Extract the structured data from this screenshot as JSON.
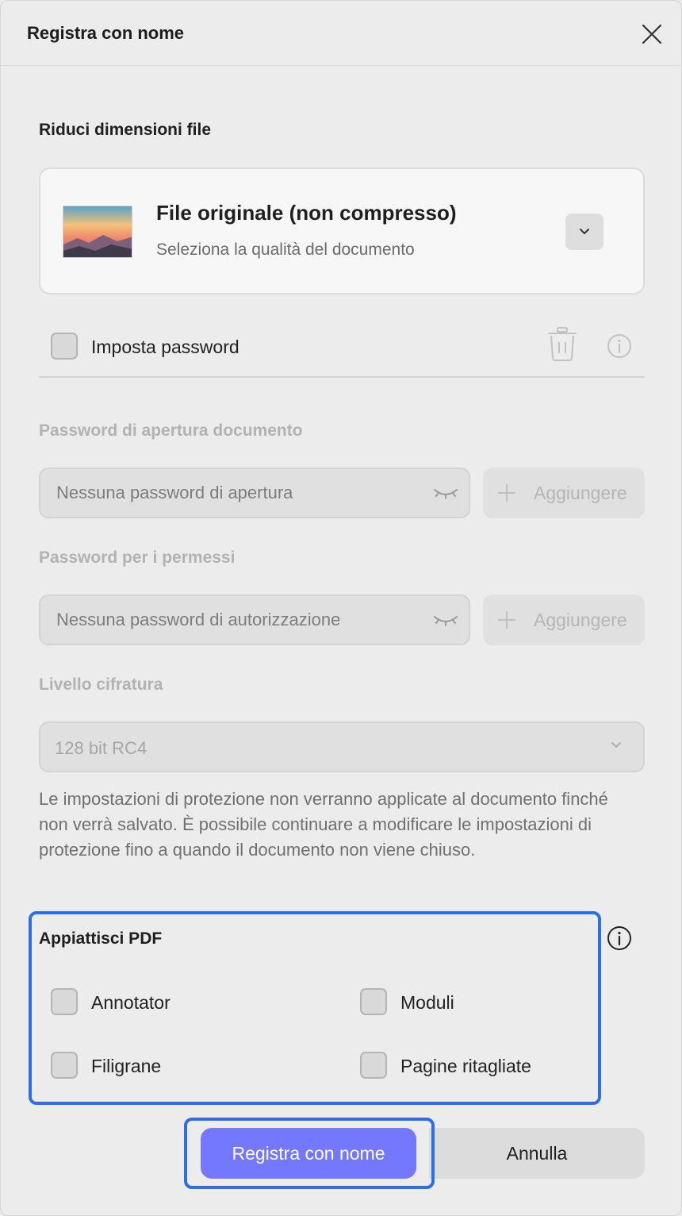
{
  "dialog": {
    "title": "Registra con nome"
  },
  "reduce": {
    "section_title": "Riduci dimensioni file",
    "card_title": "File originale (non compresso)",
    "card_subtitle": "Seleziona la qualità del documento"
  },
  "password": {
    "set_password_label": "Imposta password",
    "open_title": "Password di apertura documento",
    "open_placeholder": "Nessuna password di apertura",
    "open_add_label": "Aggiungere",
    "perm_title": "Password per i permessi",
    "perm_placeholder": "Nessuna password di autorizzazione",
    "perm_add_label": "Aggiungere",
    "encryption_title": "Livello cifratura",
    "encryption_value": "128 bit RC4",
    "note": "Le impostazioni di protezione non verranno applicate al documento finché non verrà salvato. È possibile continuare a modificare le impostazioni di protezione fino a quando il documento non viene chiuso."
  },
  "flatten": {
    "section_title": "Appiattisci PDF",
    "options": [
      "Annotator",
      "Moduli",
      "Filigrane",
      "Pagine ritagliate"
    ]
  },
  "footer": {
    "save_label": "Registra con nome",
    "cancel_label": "Annulla"
  },
  "colors": {
    "primary_button": "#7378ff",
    "highlight": "#2f6fe6"
  }
}
